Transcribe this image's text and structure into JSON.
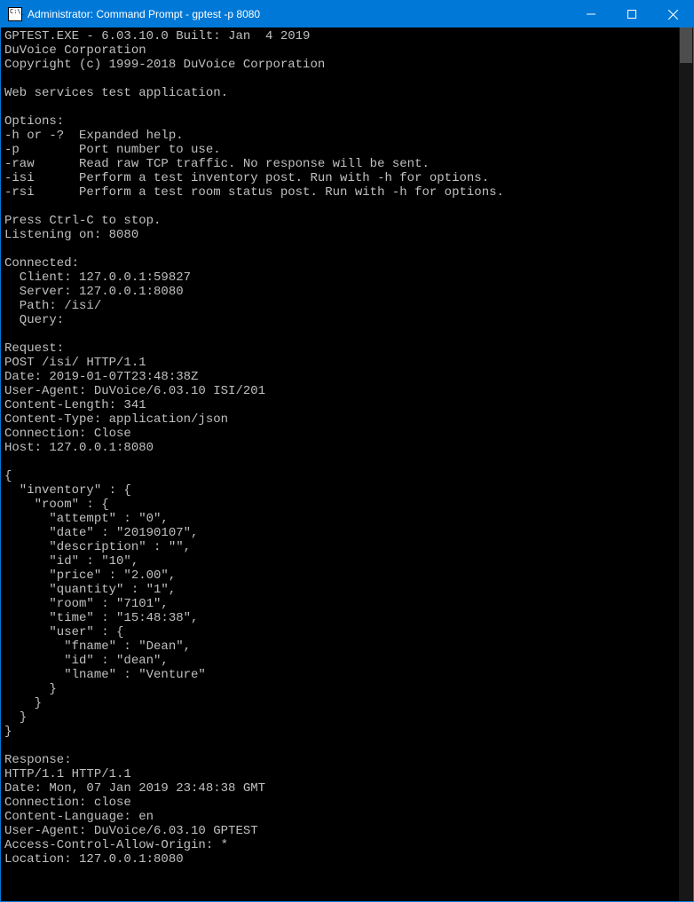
{
  "window": {
    "title": "Administrator: Command Prompt - gptest  -p 8080"
  },
  "terminal": {
    "lines": [
      "GPTEST.EXE - 6.03.10.0 Built: Jan  4 2019",
      "DuVoice Corporation",
      "Copyright (c) 1999-2018 DuVoice Corporation",
      "",
      "Web services test application.",
      "",
      "Options:",
      "-h or -?  Expanded help.",
      "-p        Port number to use.",
      "-raw      Read raw TCP traffic. No response will be sent.",
      "-isi      Perform a test inventory post. Run with -h for options.",
      "-rsi      Perform a test room status post. Run with -h for options.",
      "",
      "Press Ctrl-C to stop.",
      "Listening on: 8080",
      "",
      "Connected:",
      "  Client: 127.0.0.1:59827",
      "  Server: 127.0.0.1:8080",
      "  Path: /isi/",
      "  Query:",
      "",
      "Request:",
      "POST /isi/ HTTP/1.1",
      "Date: 2019-01-07T23:48:38Z",
      "User-Agent: DuVoice/6.03.10 ISI/201",
      "Content-Length: 341",
      "Content-Type: application/json",
      "Connection: Close",
      "Host: 127.0.0.1:8080",
      "",
      "{",
      "  \"inventory\" : {",
      "    \"room\" : {",
      "      \"attempt\" : \"0\",",
      "      \"date\" : \"20190107\",",
      "      \"description\" : \"\",",
      "      \"id\" : \"10\",",
      "      \"price\" : \"2.00\",",
      "      \"quantity\" : \"1\",",
      "      \"room\" : \"7101\",",
      "      \"time\" : \"15:48:38\",",
      "      \"user\" : {",
      "        \"fname\" : \"Dean\",",
      "        \"id\" : \"dean\",",
      "        \"lname\" : \"Venture\"",
      "      }",
      "    }",
      "  }",
      "}",
      "",
      "Response:",
      "HTTP/1.1 HTTP/1.1",
      "Date: Mon, 07 Jan 2019 23:48:38 GMT",
      "Connection: close",
      "Content-Language: en",
      "User-Agent: DuVoice/6.03.10 GPTEST",
      "Access-Control-Allow-Origin: *",
      "Location: 127.0.0.1:8080",
      ""
    ]
  }
}
